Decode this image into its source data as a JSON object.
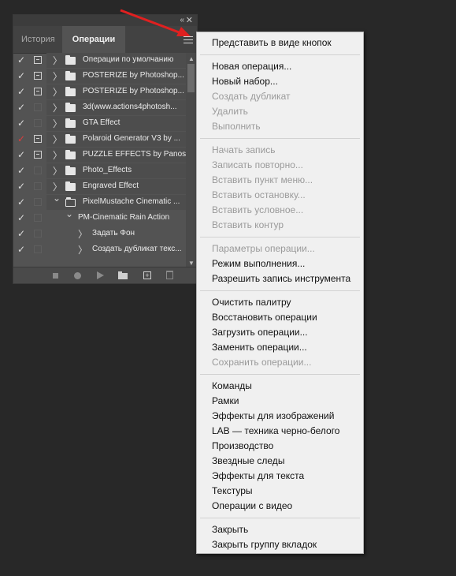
{
  "panel": {
    "collapse_icon": "«",
    "close_icon": "✕",
    "tabs": [
      {
        "label": "История",
        "active": false
      },
      {
        "label": "Операции",
        "active": true
      }
    ]
  },
  "actions": [
    {
      "check": "✓",
      "check_color": "#dcdcdc",
      "dialog": true,
      "label": "Операции по умолчанию"
    },
    {
      "check": "✓",
      "check_color": "#dcdcdc",
      "dialog": true,
      "label": "POSTERIZE by Photoshop..."
    },
    {
      "check": "✓",
      "check_color": "#dcdcdc",
      "dialog": true,
      "label": "POSTERIZE by Photoshop..."
    },
    {
      "check": "✓",
      "check_color": "#dcdcdc",
      "dialog": false,
      "label": "3d(www.actions4photosh..."
    },
    {
      "check": "✓",
      "check_color": "#dcdcdc",
      "dialog": false,
      "label": "GTA Effect"
    },
    {
      "check": "✓",
      "check_color": "#e03c3c",
      "dialog": true,
      "label": "Polaroid Generator V3 by ..."
    },
    {
      "check": "✓",
      "check_color": "#dcdcdc",
      "dialog": true,
      "label": "PUZZLE EFFECTS by Panos"
    },
    {
      "check": "✓",
      "check_color": "#dcdcdc",
      "dialog": false,
      "label": "Photo_Effects"
    },
    {
      "check": "✓",
      "check_color": "#dcdcdc",
      "dialog": false,
      "label": "Engraved Effect"
    },
    {
      "check": "✓",
      "check_color": "#dcdcdc",
      "dialog": false,
      "label": "PixelMustache Cinematic ..."
    },
    {
      "check": "✓",
      "check_color": "#dcdcdc",
      "dialog": false,
      "label": "PM-Cinematic Rain Action"
    },
    {
      "check": "✓",
      "check_color": "#dcdcdc",
      "dialog": false,
      "label": "Задать Фон"
    },
    {
      "check": "✓",
      "check_color": "#dcdcdc",
      "dialog": false,
      "label": "Создать дубликат текс..."
    }
  ],
  "menu": {
    "groups": [
      [
        {
          "label": "Представить в виде кнопок",
          "disabled": false
        }
      ],
      [
        {
          "label": "Новая операция...",
          "disabled": false
        },
        {
          "label": "Новый набор...",
          "disabled": false
        },
        {
          "label": "Создать дубликат",
          "disabled": true
        },
        {
          "label": "Удалить",
          "disabled": true
        },
        {
          "label": "Выполнить",
          "disabled": true
        }
      ],
      [
        {
          "label": "Начать запись",
          "disabled": true
        },
        {
          "label": "Записать повторно...",
          "disabled": true
        },
        {
          "label": "Вставить пункт меню...",
          "disabled": true
        },
        {
          "label": "Вставить остановку...",
          "disabled": true
        },
        {
          "label": "Вставить условное...",
          "disabled": true
        },
        {
          "label": "Вставить контур",
          "disabled": true
        }
      ],
      [
        {
          "label": "Параметры операции...",
          "disabled": true
        },
        {
          "label": "Режим выполнения...",
          "disabled": false
        },
        {
          "label": "Разрешить запись инструмента",
          "disabled": false
        }
      ],
      [
        {
          "label": "Очистить палитру",
          "disabled": false
        },
        {
          "label": "Восстановить операции",
          "disabled": false
        },
        {
          "label": "Загрузить операции...",
          "disabled": false
        },
        {
          "label": "Заменить операции...",
          "disabled": false
        },
        {
          "label": "Сохранить операции...",
          "disabled": true
        }
      ],
      [
        {
          "label": "Команды",
          "disabled": false
        },
        {
          "label": "Рамки",
          "disabled": false
        },
        {
          "label": "Эффекты для изображений",
          "disabled": false
        },
        {
          "label": "LAB — техника черно-белого",
          "disabled": false
        },
        {
          "label": "Производство",
          "disabled": false
        },
        {
          "label": "Звездные следы",
          "disabled": false
        },
        {
          "label": "Эффекты для текста",
          "disabled": false
        },
        {
          "label": "Текстуры",
          "disabled": false
        },
        {
          "label": "Операции с видео",
          "disabled": false
        }
      ],
      [
        {
          "label": "Закрыть",
          "disabled": false
        },
        {
          "label": "Закрыть группу вкладок",
          "disabled": false
        }
      ]
    ]
  },
  "colors": {
    "background": "#282828",
    "panel": "#535353",
    "menu": "#f0f0f0",
    "annotation_arrow": "#e02020"
  }
}
